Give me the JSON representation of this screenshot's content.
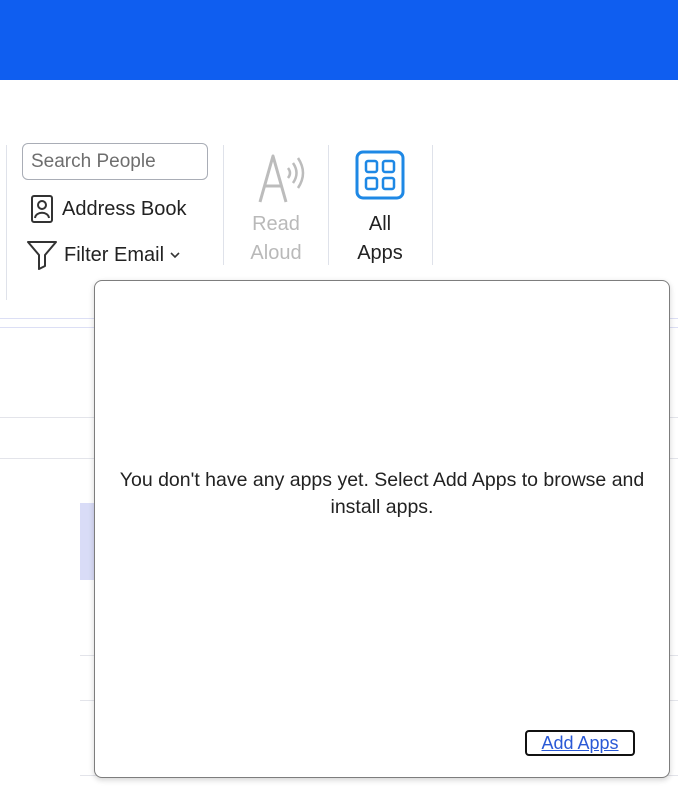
{
  "ribbon": {
    "search": {
      "placeholder": "Search People",
      "value": ""
    },
    "address_book": {
      "label": "Address Book",
      "icon": "address-book-icon"
    },
    "filter_email": {
      "label": "Filter Email",
      "icon": "filter-icon",
      "dropdown_icon": "chevron-down-icon"
    },
    "read_aloud": {
      "line1": "Read",
      "line2": "Aloud",
      "icon": "read-aloud-icon",
      "enabled": false
    },
    "all_apps": {
      "line1": "All",
      "line2": "Apps",
      "icon": "apps-grid-icon"
    }
  },
  "popup": {
    "message": "You don't have any apps yet. Select Add Apps to browse and install apps.",
    "add_apps_label": "Add Apps"
  },
  "colors": {
    "title_bar": "#0f5ef0",
    "accent_blue": "#1e88e5",
    "link": "#2a59d6",
    "selection": "#d9dcf7"
  }
}
